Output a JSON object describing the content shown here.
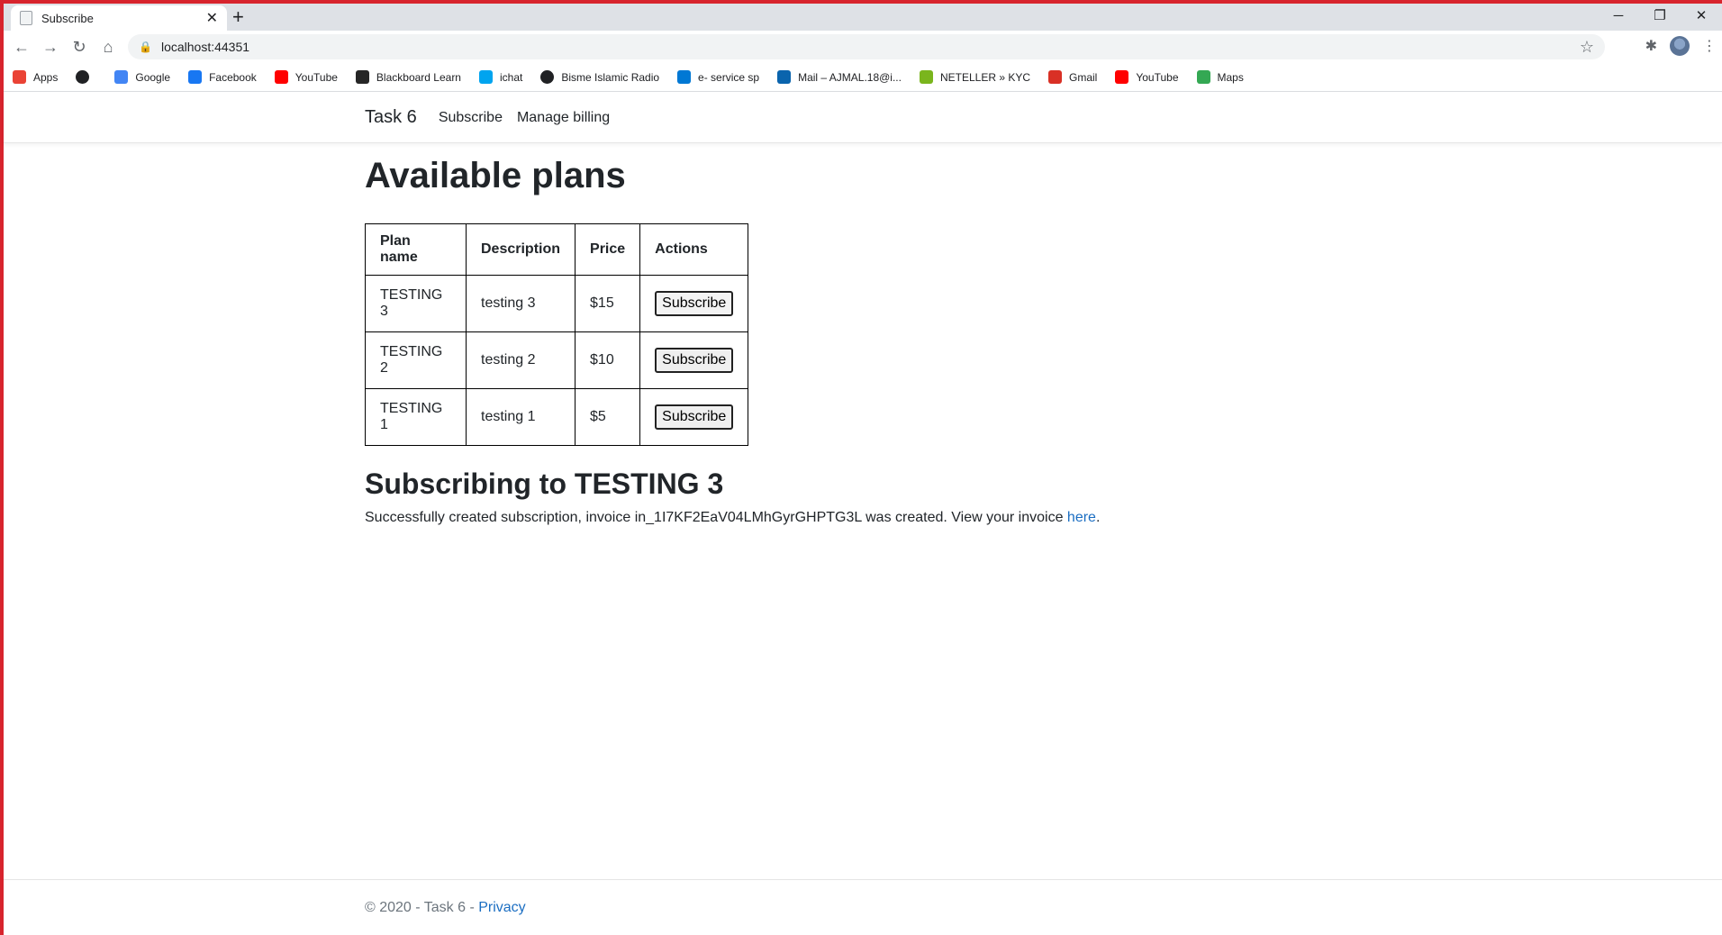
{
  "browser": {
    "tab_title": "Subscribe",
    "url": "localhost:44351",
    "bookmarks": [
      {
        "label": "Apps",
        "icon": "apps-grid-icon",
        "color": "#ea4335"
      },
      {
        "label": "",
        "icon": "globe-icon",
        "color": "#202124"
      },
      {
        "label": "Google",
        "icon": "google-icon",
        "color": "#4285f4"
      },
      {
        "label": "Facebook",
        "icon": "facebook-icon",
        "color": "#1877f2"
      },
      {
        "label": "YouTube",
        "icon": "youtube-icon",
        "color": "#ff0000"
      },
      {
        "label": "Blackboard Learn",
        "icon": "blackboard-icon",
        "color": "#262626"
      },
      {
        "label": "ichat",
        "icon": "windows-icon",
        "color": "#00a4ef"
      },
      {
        "label": "Bisme Islamic Radio",
        "icon": "radio-icon",
        "color": "#202124"
      },
      {
        "label": "e- service sp",
        "icon": "sharepoint-icon",
        "color": "#0078d4"
      },
      {
        "label": "Mail – AJMAL.18@i...",
        "icon": "outlook-icon",
        "color": "#0a64ad"
      },
      {
        "label": "NETELLER » KYC",
        "icon": "neteller-icon",
        "color": "#7ab51d"
      },
      {
        "label": "Gmail",
        "icon": "gmail-icon",
        "color": "#d93025"
      },
      {
        "label": "YouTube",
        "icon": "youtube-icon",
        "color": "#ff0000"
      },
      {
        "label": "Maps",
        "icon": "maps-icon",
        "color": "#34a853"
      }
    ]
  },
  "site": {
    "brand": "Task 6",
    "nav": [
      "Subscribe",
      "Manage billing"
    ]
  },
  "main": {
    "title": "Available plans",
    "table": {
      "headers": [
        "Plan name",
        "Description",
        "Price",
        "Actions"
      ],
      "rows": [
        {
          "plan": "TESTING 3",
          "description": "testing 3",
          "price": "$15",
          "action": "Subscribe"
        },
        {
          "plan": "TESTING 2",
          "description": "testing 2",
          "price": "$10",
          "action": "Subscribe"
        },
        {
          "plan": "TESTING 1",
          "description": "testing 1",
          "price": "$5",
          "action": "Subscribe"
        }
      ]
    },
    "subscribing_title": "Subscribing to TESTING 3",
    "message": "Successfully created subscription, invoice in_1I7KF2EaV04LMhGyrGHPTG3L was created. View your invoice ",
    "message_link": "here",
    "message_end": "."
  },
  "footer": {
    "text": "© 2020 - Task 6 - ",
    "link": "Privacy"
  },
  "colors": {
    "link": "#1b6ec2",
    "frame": "#d7242d"
  }
}
